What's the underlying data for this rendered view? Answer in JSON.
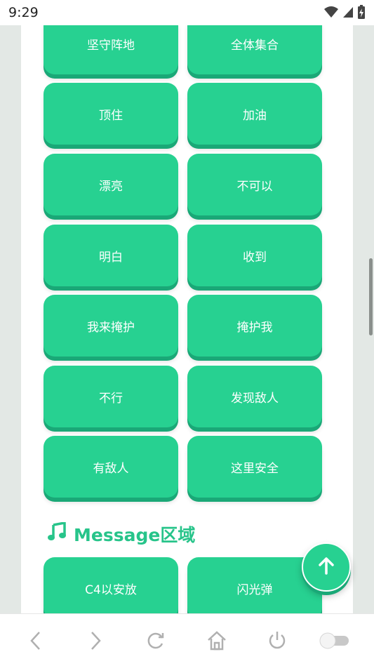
{
  "status_bar": {
    "time": "9:29",
    "icons": [
      "wifi-icon",
      "cellular-signal-icon",
      "battery-charging-icon"
    ]
  },
  "quick_messages": [
    {
      "label": "坚守阵地"
    },
    {
      "label": "全体集合"
    },
    {
      "label": "顶住"
    },
    {
      "label": "加油"
    },
    {
      "label": "漂亮"
    },
    {
      "label": "不可以"
    },
    {
      "label": "明白"
    },
    {
      "label": "收到"
    },
    {
      "label": "我来掩护"
    },
    {
      "label": "掩护我"
    },
    {
      "label": "不行"
    },
    {
      "label": "发现敌人"
    },
    {
      "label": "有敌人"
    },
    {
      "label": "这里安全"
    }
  ],
  "message_section": {
    "icon": "music-note-icon",
    "title": "Message区域",
    "buttons": [
      {
        "label": "C4以安放"
      },
      {
        "label": "闪光弹"
      }
    ]
  },
  "fab": {
    "icon": "arrow-up-icon"
  },
  "nav_bar": {
    "icons": [
      "back-icon",
      "forward-icon",
      "reload-icon",
      "home-icon",
      "power-icon",
      "toggle-switch-icon"
    ]
  },
  "colors": {
    "accent": "#27d191",
    "accent_shadow": "#1aa877",
    "heading": "#27c48a"
  }
}
